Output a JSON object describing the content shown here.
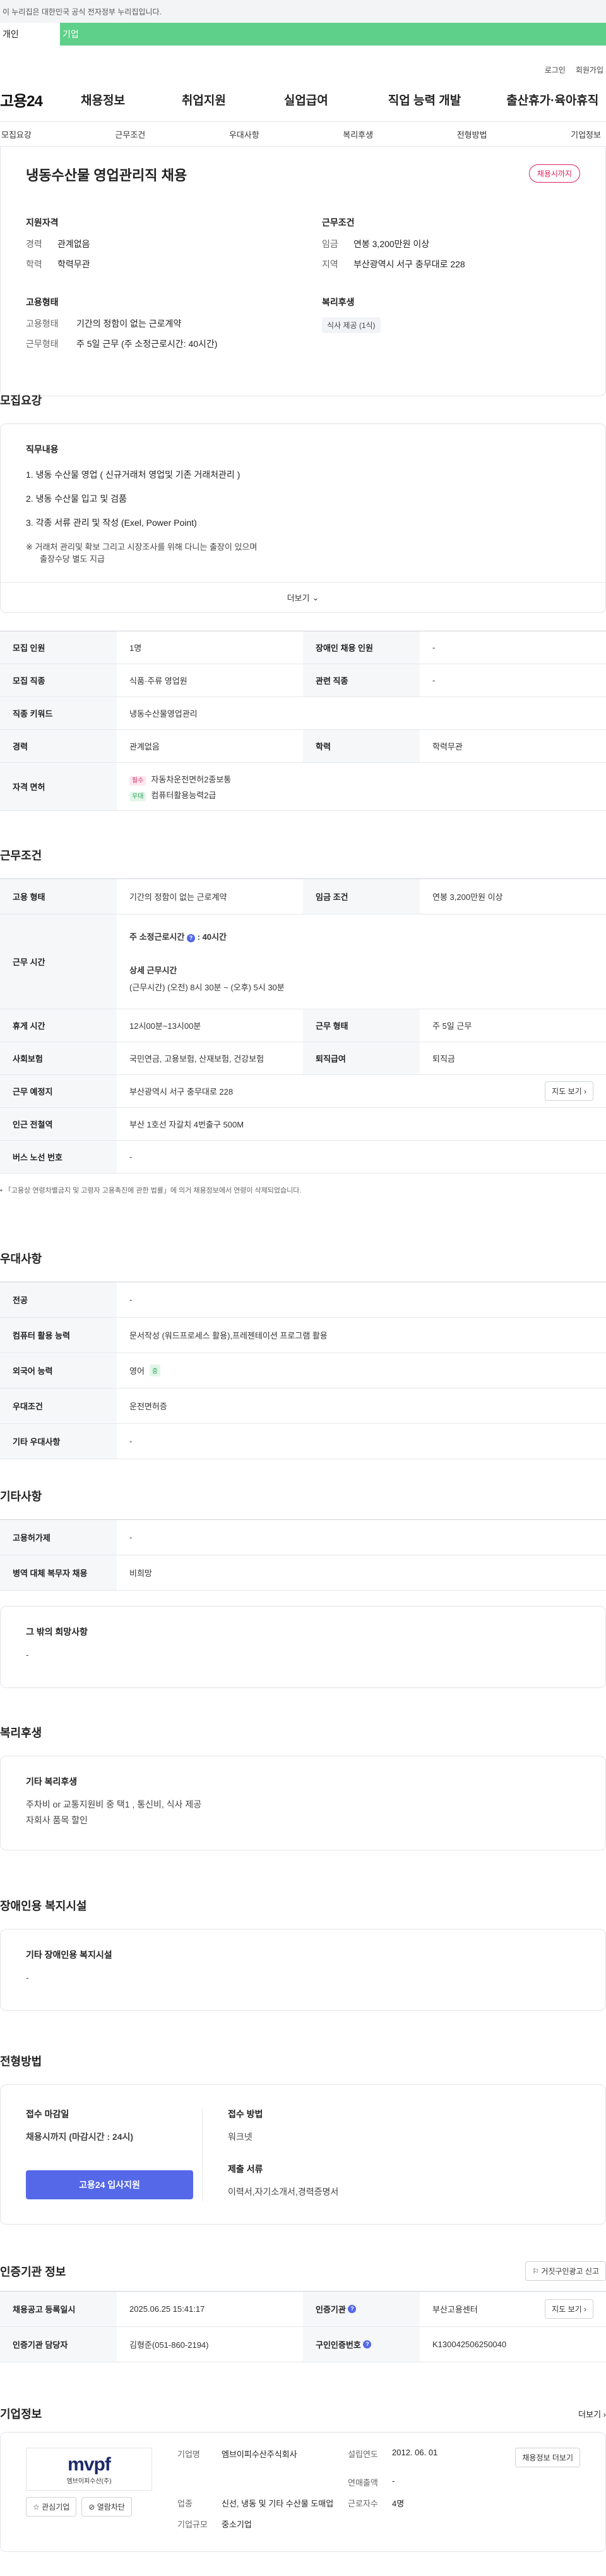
{
  "gov_notice": "이 누리집은 대한민국 공식 전자정부 누리집입니다.",
  "tabs": {
    "person": "개인",
    "corp": "기업"
  },
  "util": {
    "login": "로그인",
    "signup": "회원가입"
  },
  "logo": "고용24",
  "gnb": [
    "채용정보",
    "취업지원",
    "실업급여",
    "직업 능력 개발",
    "출산휴가·육아휴직"
  ],
  "subnav": [
    "모집요강",
    "근무조건",
    "우대사항",
    "복리후생",
    "전형방법",
    "기업정보"
  ],
  "summary": {
    "title": "냉동수산물 영업관리직 채용",
    "badge": "채용시까지",
    "qual_title": "지원자격",
    "qual": [
      {
        "k": "경력",
        "v": "관계없음"
      },
      {
        "k": "학력",
        "v": "학력무관"
      }
    ],
    "cond_title": "근무조건",
    "cond": [
      {
        "k": "임금",
        "v": "연봉 3,200만원 이상"
      },
      {
        "k": "지역",
        "v": "부산광역시 서구 충무대로 228"
      }
    ],
    "emp_title": "고용형태",
    "emp": [
      {
        "k": "고용형태",
        "v": "기간의 정함이 없는 근로계약"
      },
      {
        "k": "근무형태",
        "v": "주 5일 근무 (주 소정근로시간: 40시간)"
      }
    ],
    "welfare_title": "복리후생",
    "welfare_chip": "식사 제공 (1식)"
  },
  "recruit": {
    "title": "모집요강",
    "duty_title": "직무내용",
    "duties": [
      "1. 냉동 수산물 영업 ( 신규거래처 영업및 기존 거래처관리 )",
      "2. 냉동 수산물 입고 및 검품",
      "3. 각종 서류 관리 및 작성 (Exel, Power Point)"
    ],
    "duty_note": "※ 거래처 관리및 확보 그리고 시장조사를 위해 다니는 출장이 있으며",
    "duty_note2": "출장수당 별도 지급",
    "more": "더보기",
    "rows": {
      "count_k": "모집 인원",
      "count_v": "1명",
      "disabled_k": "장애인 채용 인원",
      "disabled_v": "-",
      "job_k": "모집 직종",
      "job_v": "식품·주류 영업원",
      "rel_k": "관련 직종",
      "rel_v": "-",
      "kw_k": "직종 키워드",
      "kw_v": "냉동수산물영업관리",
      "exp_k": "경력",
      "exp_v": "관계없음",
      "edu_k": "학력",
      "edu_v": "학력무관",
      "lic_k": "자격 면허",
      "lic1_tag": "필수",
      "lic1": "자동차운전면허2종보통",
      "lic2_tag": "우대",
      "lic2": "컴퓨터활용능력2급"
    }
  },
  "work": {
    "title": "근무조건",
    "type_k": "고용 형태",
    "type_v": "기간의 정함이 없는 근로계약",
    "wage_k": "임금 조건",
    "wage_v": "연봉 3,200만원 이상",
    "hours_k": "근무 시간",
    "hours_main": "주 소정근로시간",
    "hours_main_v": ": 40시간",
    "hours_detail_title": "상세 근무시간",
    "hours_detail": "(근무시간) (오전) 8시 30분 ~ (오후) 5시 30분",
    "rest_k": "휴게 시간",
    "rest_v": "12시00분~13시00분",
    "form_k": "근무 형태",
    "form_v": "주 5일 근무",
    "ins_k": "사회보험",
    "ins_v": "국민연금, 고용보험, 산재보험, 건강보험",
    "sev_k": "퇴직급여",
    "sev_v": "퇴직금",
    "place_k": "근무 예정지",
    "place_v": "부산광역시 서구 충무대로 228",
    "map_btn": "지도 보기",
    "sub_k": "인근 전철역",
    "sub_v": "부산 1호선 자갈치 4번출구 500M",
    "bus_k": "버스 노선 번호",
    "bus_v": "-",
    "note": "• 「고용상 연령차별금지 및 고령자 고용촉진에 관한 법률」에 의거 채용정보에서 연령이 삭제되었습니다."
  },
  "pref": {
    "title": "우대사항",
    "major_k": "전공",
    "major_v": "-",
    "pc_k": "컴퓨터 활용 능력",
    "pc_v": "문서작성 (워드프로세스 활용),프레젠테이션 프로그램 활용",
    "lang_k": "외국어 능력",
    "lang_v": "영어",
    "lang_lv": "중",
    "cond_k": "우대조건",
    "cond_v": "운전면허증",
    "etc_k": "기타 우대사항",
    "etc_v": "-"
  },
  "other": {
    "title": "기타사항",
    "empl_k": "고용허가제",
    "empl_v": "-",
    "mil_k": "병역 대체 복무자 채용",
    "mil_v": "비희망",
    "hope_title": "그 밖의 희망사항",
    "hope_v": "-"
  },
  "benefit": {
    "title": "복리후생",
    "box_title": "기타 복리후생",
    "line1": "주차비 or 교통지원비 중 택1 , 통신비, 식사 제공",
    "line2": "자회사 품목 할인"
  },
  "facility": {
    "title": "장애인용 복지시설",
    "box_title": "기타 장애인용 복지시설",
    "value": "-"
  },
  "process": {
    "title": "전형방법",
    "deadline_title": "접수 마감일",
    "deadline_v": "채용시까지 (마감시간 : 24시)",
    "apply_btn": "고용24 입사지원",
    "method_title": "접수 방법",
    "method_v": "워크넷",
    "docs_title": "제출 서류",
    "docs_v": "이력서,자기소개서,경력증명서"
  },
  "cert": {
    "title": "인증기관 정보",
    "report_btn": "거짓구인광고 신고",
    "reg_k": "채용공고 등록일시",
    "reg_v": "2025.06.25 15:41:17",
    "org_k": "인증기관",
    "org_v": "부산고용센터",
    "map_btn": "지도 보기",
    "mgr_k": "인증기관 담당자",
    "mgr_v": "김형준(051-860-2194)",
    "no_k": "구인인증번호",
    "no_v": "K130042506250040"
  },
  "company": {
    "title": "기업정보",
    "more": "더보기",
    "logo_text": "mvpf",
    "logo_sub": "엠브이피수산(주)",
    "fav_btn": "관심기업",
    "block_btn": "열람차단",
    "name_k": "기업명",
    "name_v": "엠브이피수산주식회사",
    "est_k": "설립연도",
    "est_v": "2012. 06. 01",
    "sales_k": "연매출액",
    "sales_v": "-",
    "biz_k": "업종",
    "biz_v": "신선, 냉동 및 기타 수산물 도매업",
    "emp_k": "근로자수",
    "emp_v": "4명",
    "size_k": "기업규모",
    "size_v": "중소기업",
    "jobs_btn": "채용정보 더보기"
  }
}
